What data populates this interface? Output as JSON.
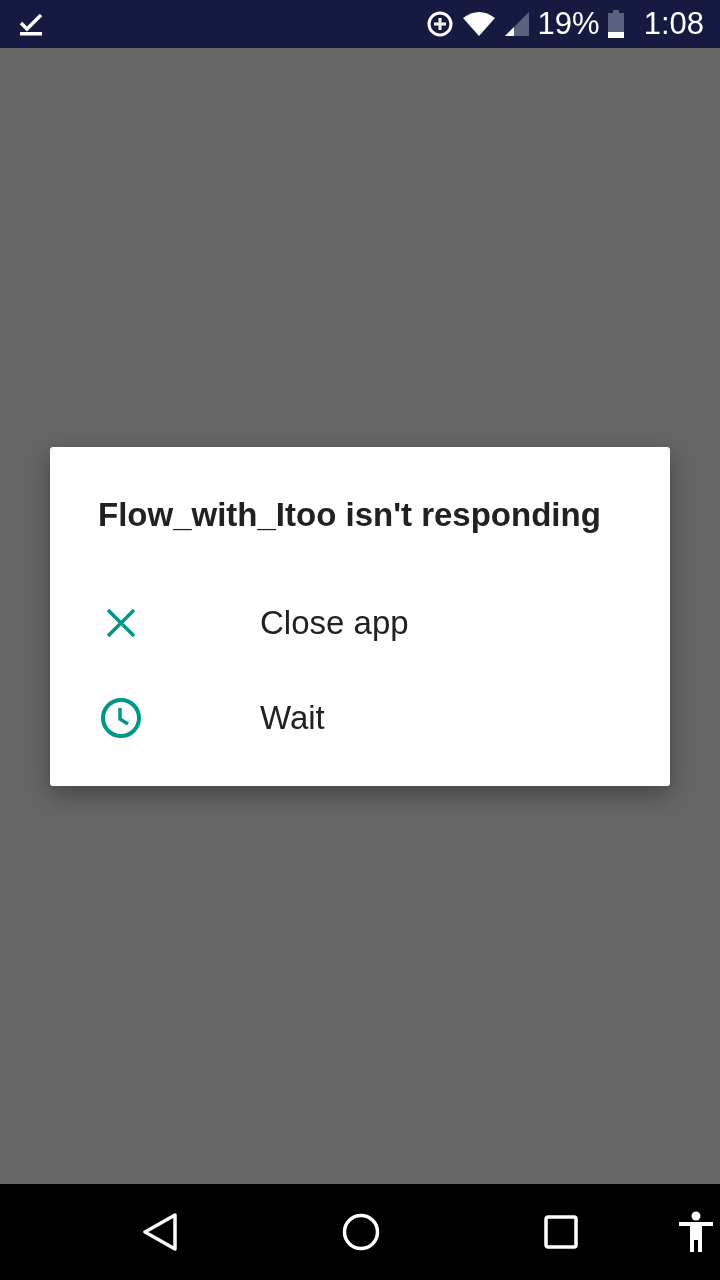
{
  "status_bar": {
    "battery": "19%",
    "time": "1:08"
  },
  "dialog": {
    "title": "Flow_with_Itoo isn't responding",
    "options": [
      {
        "kind": "close",
        "label": "Close app"
      },
      {
        "kind": "wait",
        "label": "Wait"
      }
    ]
  }
}
